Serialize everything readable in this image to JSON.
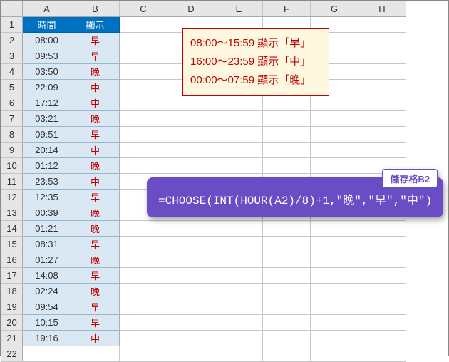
{
  "columns": [
    "A",
    "B",
    "C",
    "D",
    "E",
    "F",
    "G",
    "H"
  ],
  "header": {
    "a": "時間",
    "b": "顯示"
  },
  "rows": [
    {
      "n": "1"
    },
    {
      "n": "2",
      "a": "08:00",
      "b": "早"
    },
    {
      "n": "3",
      "a": "09:53",
      "b": "早"
    },
    {
      "n": "4",
      "a": "03:50",
      "b": "晚"
    },
    {
      "n": "5",
      "a": "22:09",
      "b": "中"
    },
    {
      "n": "6",
      "a": "17:12",
      "b": "中"
    },
    {
      "n": "7",
      "a": "03:21",
      "b": "晚"
    },
    {
      "n": "8",
      "a": "09:51",
      "b": "早"
    },
    {
      "n": "9",
      "a": "20:14",
      "b": "中"
    },
    {
      "n": "10",
      "a": "01:12",
      "b": "晚"
    },
    {
      "n": "11",
      "a": "23:53",
      "b": "中"
    },
    {
      "n": "12",
      "a": "12:35",
      "b": "早"
    },
    {
      "n": "13",
      "a": "00:39",
      "b": "晚"
    },
    {
      "n": "14",
      "a": "01:21",
      "b": "晚"
    },
    {
      "n": "15",
      "a": "08:31",
      "b": "早"
    },
    {
      "n": "16",
      "a": "01:27",
      "b": "晚"
    },
    {
      "n": "17",
      "a": "14:08",
      "b": "早"
    },
    {
      "n": "18",
      "a": "02:24",
      "b": "晚"
    },
    {
      "n": "19",
      "a": "09:54",
      "b": "早"
    },
    {
      "n": "20",
      "a": "10:15",
      "b": "早"
    },
    {
      "n": "21",
      "a": "19:16",
      "b": "中"
    },
    {
      "n": "22"
    }
  ],
  "infoBox": {
    "line1": "08:00～15:59 顯示「早」",
    "line2": "16:00～23:59 顯示「中」",
    "line3": "00:00～07:59 顯示「晚」"
  },
  "callout": {
    "label": "儲存格B2",
    "formula": "=CHOOSE(INT(HOUR(A2)/8)+1,\"晚\",\"早\",\"中\")"
  }
}
